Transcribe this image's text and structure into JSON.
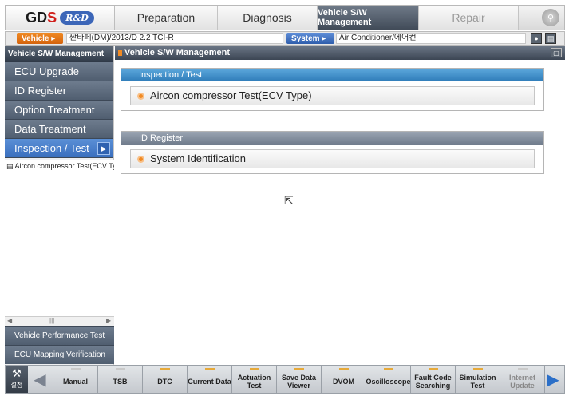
{
  "app": {
    "logo": {
      "brand_left": "GD",
      "brand_right": "S",
      "badge": "R&D"
    },
    "tabs": [
      {
        "label": "Preparation",
        "active": false
      },
      {
        "label": "Diagnosis",
        "active": false
      },
      {
        "label": "Vehicle S/W Management",
        "active": true
      },
      {
        "label": "Repair",
        "active": false
      }
    ]
  },
  "vehicle_bar": {
    "vehicle_button": "Vehicle",
    "vehicle_value": "싼타페(DM)/2013/D 2.2 TCI-R",
    "system_button": "System",
    "system_value": "Air Conditioner/에어컨"
  },
  "sidebar": {
    "title": "Vehicle S/W Management",
    "items": [
      {
        "label": "ECU Upgrade",
        "active": false
      },
      {
        "label": "ID Register",
        "active": false
      },
      {
        "label": "Option Treatment",
        "active": false
      },
      {
        "label": "Data Treatment",
        "active": false
      },
      {
        "label": "Inspection / Test",
        "active": true
      }
    ],
    "tree": [
      "Aircon compressor Test(ECV Type)"
    ],
    "footer": [
      "Vehicle Performance Test",
      "ECU Mapping Verification"
    ]
  },
  "main": {
    "title": "Vehicle S/W Management",
    "panels": [
      {
        "header": "Inspection / Test",
        "button": "Aircon compressor Test(ECV Type)"
      },
      {
        "header": "ID Register",
        "button": "System Identification"
      }
    ]
  },
  "toolbar": {
    "settings_label": "설정",
    "tools": [
      {
        "label": "Manual"
      },
      {
        "label": "TSB"
      },
      {
        "label": "DTC"
      },
      {
        "label": "Current Data"
      },
      {
        "label": "Actuation Test"
      },
      {
        "label": "Save Data Viewer"
      },
      {
        "label": "DVOM"
      },
      {
        "label": "Oscilloscope"
      },
      {
        "label": "Fault Code Searching"
      },
      {
        "label": "Simulation Test"
      },
      {
        "label": "Internet Update"
      }
    ]
  },
  "colors": {
    "accent_orange": "#f08a24",
    "active_blue": "#3a6fbe",
    "panel_blue": "#2f7cb9"
  }
}
